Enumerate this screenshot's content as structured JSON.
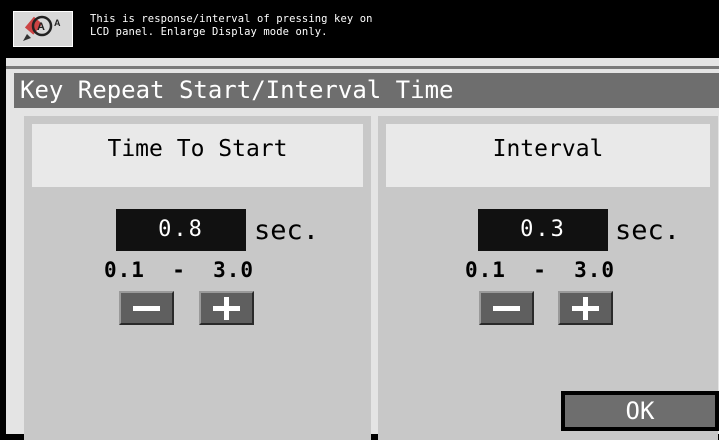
{
  "message": {
    "icon": "accessibility-zoom-icon",
    "line1": "This is response/interval of pressing key on",
    "line2": "LCD panel. Enlarge Display mode only."
  },
  "title": "Key Repeat Start/Interval Time",
  "start": {
    "header": "Time To Start",
    "value": "0.8",
    "unit": "sec.",
    "range": "0.1  -  3.0"
  },
  "interval": {
    "header": "Interval",
    "value": "0.3",
    "unit": "sec.",
    "range": "0.1  -  3.0"
  },
  "ok_label": "OK",
  "colors": {
    "title_bar": "#6e6e6e",
    "group_bg": "#c8c8c8",
    "panel_bg": "#e4e4e4",
    "value_box": "#111111"
  }
}
